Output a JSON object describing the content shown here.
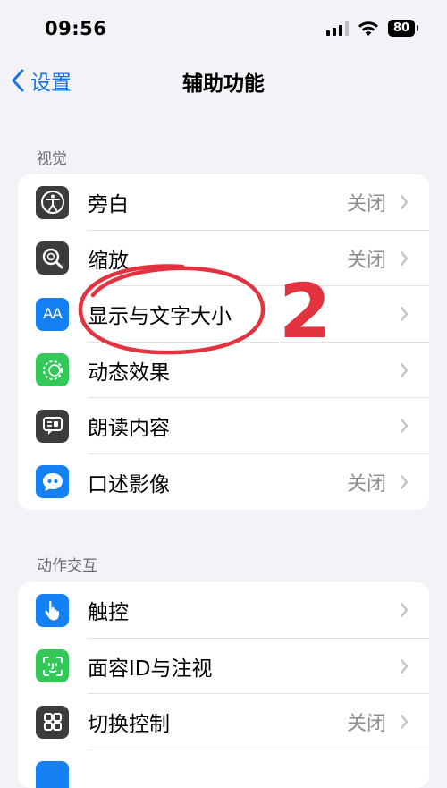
{
  "status_bar": {
    "time": "09:56",
    "battery": "80"
  },
  "nav": {
    "back_label": "设置",
    "title": "辅助功能"
  },
  "sections": [
    {
      "header": "视觉",
      "items": [
        {
          "label": "旁白",
          "value": "关闭",
          "icon": "voiceover-icon"
        },
        {
          "label": "缩放",
          "value": "关闭",
          "icon": "zoom-icon"
        },
        {
          "label": "显示与文字大小",
          "value": "",
          "icon": "text-size-icon",
          "icon_text": "AA"
        },
        {
          "label": "动态效果",
          "value": "",
          "icon": "motion-icon"
        },
        {
          "label": "朗读内容",
          "value": "",
          "icon": "spoken-content-icon"
        },
        {
          "label": "口述影像",
          "value": "关闭",
          "icon": "audio-description-icon"
        }
      ]
    },
    {
      "header": "动作交互",
      "items": [
        {
          "label": "触控",
          "value": "",
          "icon": "touch-icon"
        },
        {
          "label": "面容ID与注视",
          "value": "",
          "icon": "face-id-icon"
        },
        {
          "label": "切换控制",
          "value": "关闭",
          "icon": "switch-control-icon"
        }
      ]
    }
  ],
  "annotation": {
    "number": "2",
    "color": "#e2333e"
  }
}
